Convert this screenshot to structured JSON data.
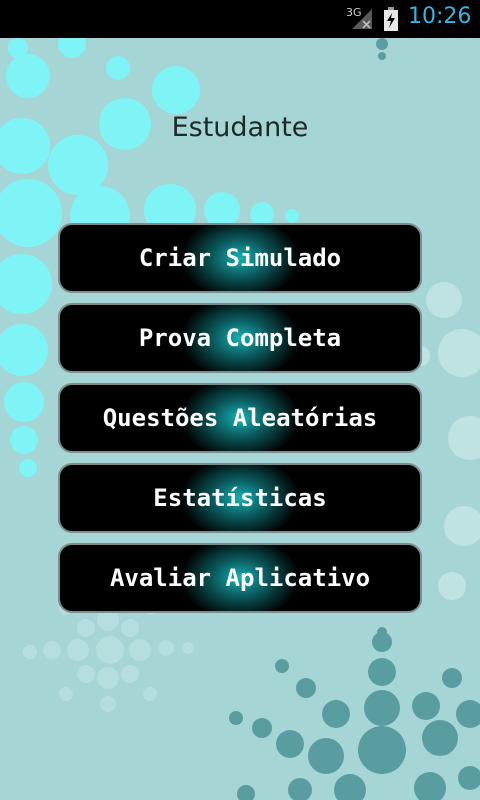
{
  "status_bar": {
    "network": "3G",
    "time": "10:26",
    "signal_icon": "signal-icon",
    "battery_icon": "battery-charging-icon"
  },
  "screen": {
    "title": "Estudante"
  },
  "menu": {
    "items": [
      {
        "label": "Criar Simulado"
      },
      {
        "label": "Prova Completa"
      },
      {
        "label": "Questões Aleatórias"
      },
      {
        "label": "Estatísticas"
      },
      {
        "label": "Avaliar Aplicativo"
      }
    ]
  },
  "colors": {
    "background": "#a6d5d6",
    "accent_cyan": "#33b5e5",
    "button_glow": "#16babd",
    "button_bg": "#000000"
  }
}
